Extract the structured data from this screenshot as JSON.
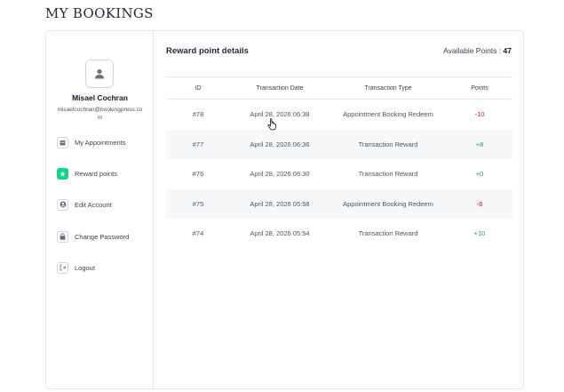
{
  "page": {
    "heading": "MY BOOKINGS"
  },
  "user": {
    "name": "Misael Cochran",
    "email": "misaelcochran@bookingpress.com"
  },
  "menu": [
    {
      "label": "My Appointments",
      "icon": "calendar-icon",
      "active": false
    },
    {
      "label": "Reward points",
      "icon": "star-icon",
      "active": true
    },
    {
      "label": "Edit Account",
      "icon": "user-circle-icon",
      "active": false
    },
    {
      "label": "Change Password",
      "icon": "lock-icon",
      "active": false
    },
    {
      "label": "Logout",
      "icon": "logout-icon",
      "active": false
    }
  ],
  "rewards": {
    "title": "Reward point details",
    "available_label": "Available Points :",
    "available_value": "47",
    "columns": [
      "ID",
      "Transaction Date",
      "Transaction Type",
      "Points"
    ],
    "rows": [
      {
        "id": "#78",
        "date": "April 28, 2026 06:38",
        "type": "Appointment Booking Redeem",
        "points": "-10"
      },
      {
        "id": "#77",
        "date": "April 28, 2026 06:36",
        "type": "Transaction Reward",
        "points": "+8"
      },
      {
        "id": "#76",
        "date": "April 28, 2026 06:30",
        "type": "Transaction Reward",
        "points": "+0"
      },
      {
        "id": "#75",
        "date": "April 28, 2026 05:58",
        "type": "Appointment Booking Redeem",
        "points": "-8"
      },
      {
        "id": "#74",
        "date": "April 28, 2026 05:54",
        "type": "Transaction Reward",
        "points": "+10"
      }
    ]
  },
  "colors": {
    "accent": "#12d488",
    "negative": "#b91c1c",
    "positive": "#16a34a"
  }
}
